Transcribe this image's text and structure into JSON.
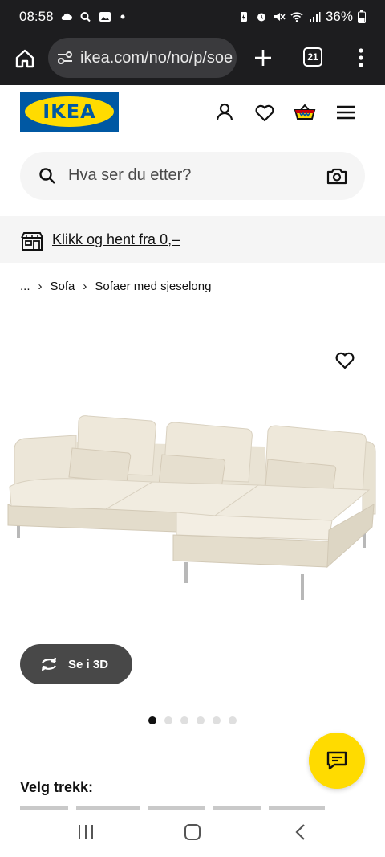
{
  "status_bar": {
    "time": "08:58",
    "battery": "36%",
    "icons": [
      "cloud-icon",
      "search-icon",
      "gallery-icon",
      "dot-icon",
      "battery-saver-icon",
      "alarm-icon",
      "mute-icon",
      "wifi-icon",
      "signal-icon",
      "battery-icon"
    ]
  },
  "browser": {
    "url": "ikea.com/no/no/p/soe",
    "tab_count": "21",
    "icons": [
      "home-icon",
      "site-settings-icon",
      "new-tab-icon",
      "tabs-icon",
      "more-icon"
    ]
  },
  "header": {
    "logo_text": "IKEA",
    "icons": [
      "profile-icon",
      "favourites-icon",
      "basket-icon",
      "menu-icon"
    ]
  },
  "search": {
    "placeholder": "Hva ser du etter?",
    "icons": [
      "search-icon",
      "camera-search-icon"
    ]
  },
  "banner": {
    "text": "Klikk og hent fra 0,–",
    "icon": "store-icon"
  },
  "breadcrumb": {
    "items": [
      "...",
      "Sofa",
      "Sofaer med sjeselong"
    ]
  },
  "product": {
    "view_3d_label": "Se i 3D",
    "image_count": 6,
    "active_image": 1
  },
  "section": {
    "title": "Velg trekk:"
  },
  "colors": {
    "ikea_blue": "#0058a3",
    "ikea_yellow": "#ffdb00",
    "dark_bar": "#1d1d1f",
    "light_gray": "#f5f5f5"
  }
}
